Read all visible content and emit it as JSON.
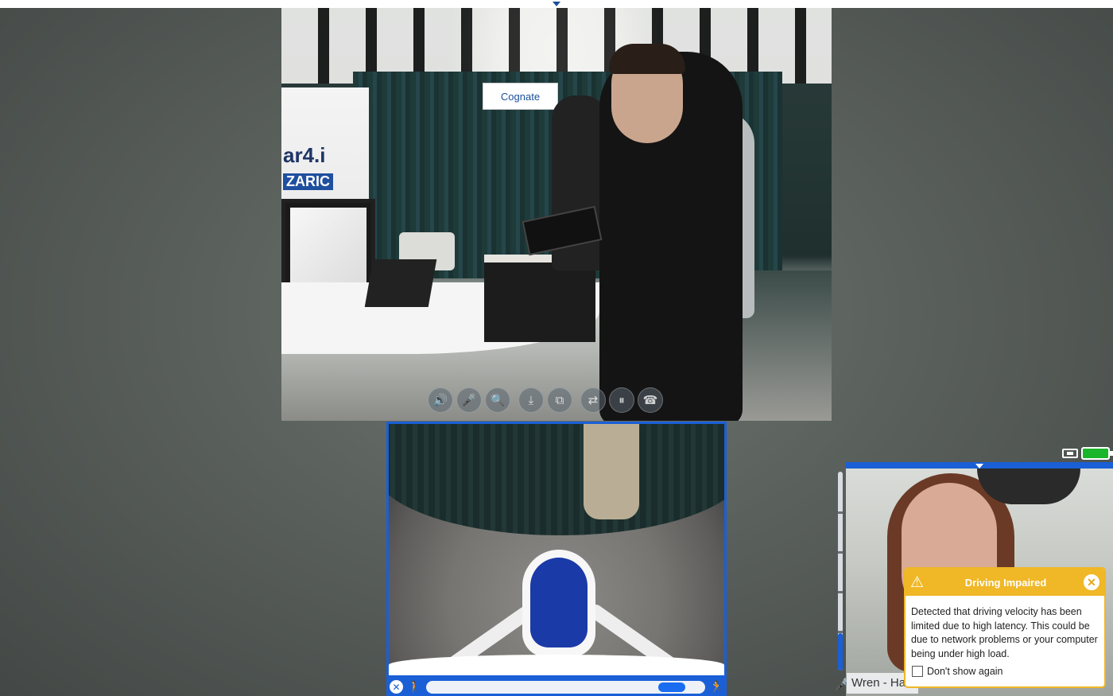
{
  "main_video": {
    "sign_text": "Cognate",
    "booth_text_1": "ar4.i",
    "booth_text_2": "ZARIC"
  },
  "video_toolbar": {
    "buttons": [
      {
        "name": "speaker-icon",
        "glyph": "🔊"
      },
      {
        "name": "microphone-icon",
        "glyph": "🎤"
      },
      {
        "name": "zoom-icon",
        "glyph": "🔍"
      },
      {
        "name": "download-icon",
        "glyph": "⤓"
      },
      {
        "name": "screenshot-icon",
        "glyph": "⧉"
      },
      {
        "name": "switch-camera-icon",
        "glyph": "⇄"
      },
      {
        "name": "pause-icon",
        "glyph": "⏸"
      },
      {
        "name": "hangup-icon",
        "glyph": "☎"
      }
    ]
  },
  "drive_bar": {
    "speed_fraction": 0.93,
    "icons": {
      "close": "close-icon",
      "walk_slow": "walk-icon",
      "walk_fast": "run-icon"
    }
  },
  "status": {
    "battery_color": "#19b62c",
    "network_icon": "network-icon"
  },
  "self_view": {
    "name": "Wren - Ha",
    "volume_fraction": 0.19
  },
  "warning_popup": {
    "title": "Driving Impaired",
    "message": "Detected that driving velocity has been limited due to high latency. This could be due to network problems or your computer being under high load.",
    "checkbox_label": "Don't show again",
    "accent_color": "#f0b726"
  }
}
